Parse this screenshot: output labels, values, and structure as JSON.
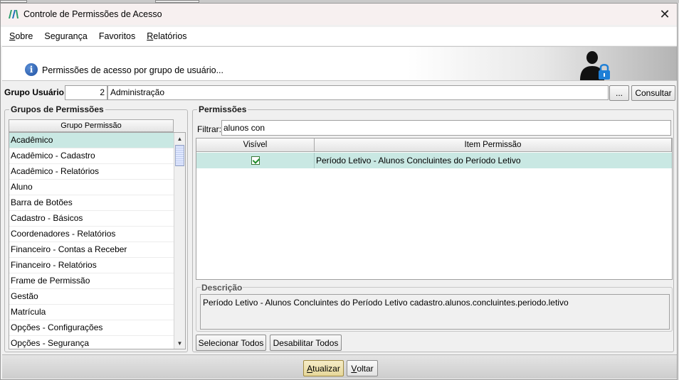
{
  "window": {
    "title": "Controle de Permissões de Acesso",
    "close_glyph": "✕"
  },
  "menu": [
    {
      "pre": "",
      "accel": "S",
      "post": "obre"
    },
    {
      "pre": "",
      "accel": "",
      "post": "Segurança"
    },
    {
      "pre": "",
      "accel": "",
      "post": "Favoritos"
    },
    {
      "pre": "",
      "accel": "R",
      "post": "elatórios"
    }
  ],
  "header": {
    "info_glyph": "i",
    "text": "Permissões de acesso por grupo de usuário..."
  },
  "grupo_usuario": {
    "label": "Grupo Usuário:",
    "code": "2",
    "name": "Administração",
    "dots_label": "...",
    "consultar_label": "Consultar"
  },
  "grupos_permissoes": {
    "title": "Grupos de Permissões",
    "column_header": "Grupo Permissão",
    "items": [
      "Acadêmico",
      "Acadêmico - Cadastro",
      "Acadêmico - Relatórios",
      "Aluno",
      "Barra de Botões",
      "Cadastro - Básicos",
      "Coordenadores - Relatórios",
      "Financeiro - Contas a Receber",
      "Financeiro - Relatórios",
      "Frame de Permissão",
      "Gestão",
      "Matrícula",
      "Opções - Configurações",
      "Opções - Segurança"
    ],
    "selected_index": 0
  },
  "permissoes": {
    "title": "Permissões",
    "filter_label": "Filtrar:",
    "filter_value": "alunos con",
    "columns": [
      "Visível",
      "Item Permissão"
    ],
    "rows": [
      {
        "visible": true,
        "item": "Período Letivo - Alunos Concluintes do Período Letivo"
      }
    ],
    "description_title": "Descrição",
    "description": "Período Letivo - Alunos Concluintes do Período Letivo cadastro.alunos.concluintes.periodo.letivo",
    "select_all_label": "Selecionar Todos",
    "disable_all_label": "Desabilitar Todos"
  },
  "footer": {
    "atualizar": {
      "accel": "A",
      "rest": "tualizar"
    },
    "voltar": {
      "accel": "V",
      "rest": "oltar"
    }
  },
  "colors": {
    "selection": "#c9e8e3",
    "primary_button": "#e6d79a"
  }
}
